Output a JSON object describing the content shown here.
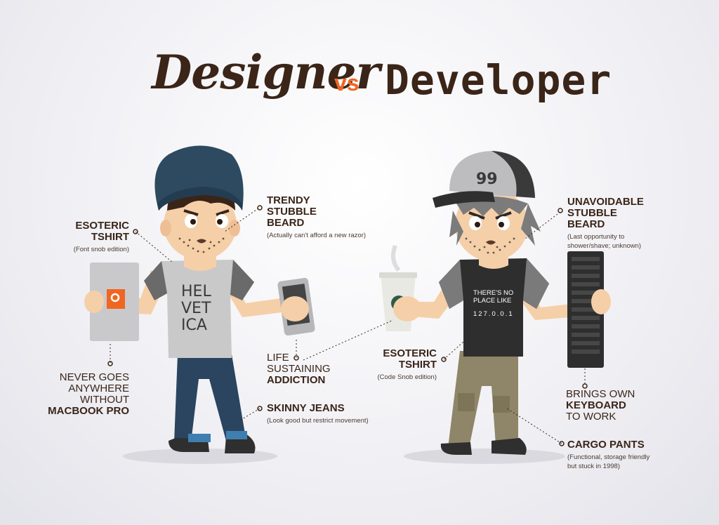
{
  "title": {
    "left": "Designer",
    "vs": "vs",
    "right": "Developer"
  },
  "designer": {
    "tshirt": {
      "label_line1": "ESOTERIC",
      "label_line2": "TSHIRT",
      "sub": "(Font snob edition)"
    },
    "beard": {
      "label_line1": "TRENDY",
      "label_line2": "STUBBLE",
      "label_line3": "BEARD",
      "sub": "(Actually can't afford a new razor)"
    },
    "macbook": {
      "line1": "NEVER GOES",
      "line2": "ANYWHERE",
      "line3": "WITHOUT",
      "line4": "MACBOOK PRO"
    },
    "jeans": {
      "label": "SKINNY JEANS",
      "sub": "(Look good but restrict movement)"
    },
    "shirt_print": {
      "line1": "HEL",
      "line2": "VET",
      "line3": "ICA"
    }
  },
  "center": {
    "line1": "LIFE",
    "line2": "SUSTAINING",
    "line3": "ADDICTION"
  },
  "developer": {
    "beard": {
      "label_line1": "UNAVOIDABLE",
      "label_line2": "STUBBLE",
      "label_line3": "BEARD",
      "sub_line1": "(Last opportunity to",
      "sub_line2": "shower/shave; unknown)"
    },
    "tshirt": {
      "label_line1": "ESOTERIC",
      "label_line2": "TSHIRT",
      "sub": "(Code Snob edition)"
    },
    "keyboard": {
      "line1": "BRINGS OWN",
      "line2": "KEYBOARD",
      "line3": "TO WORK"
    },
    "pants": {
      "label": "CARGO PANTS",
      "sub_line1": "(Functional, storage friendly",
      "sub_line2": "but stuck in 1998)"
    },
    "shirt_print": {
      "line1": "THERE'S NO",
      "line2": "PLACE LIKE",
      "line3": "127.0.0.1"
    },
    "cap_text": "99"
  },
  "colors": {
    "accent": "#ef6622",
    "ink": "#3a2518",
    "skin": "#f5cfa8",
    "beanie": "#2e4a60",
    "jeans": "#2b4560",
    "cargo": "#8f8568"
  },
  "icons": [
    "macbook-logo-icon",
    "smartphone-icon",
    "coffee-cup-icon",
    "keyboard-icon",
    "baseball-cap-icon",
    "beanie-icon"
  ]
}
